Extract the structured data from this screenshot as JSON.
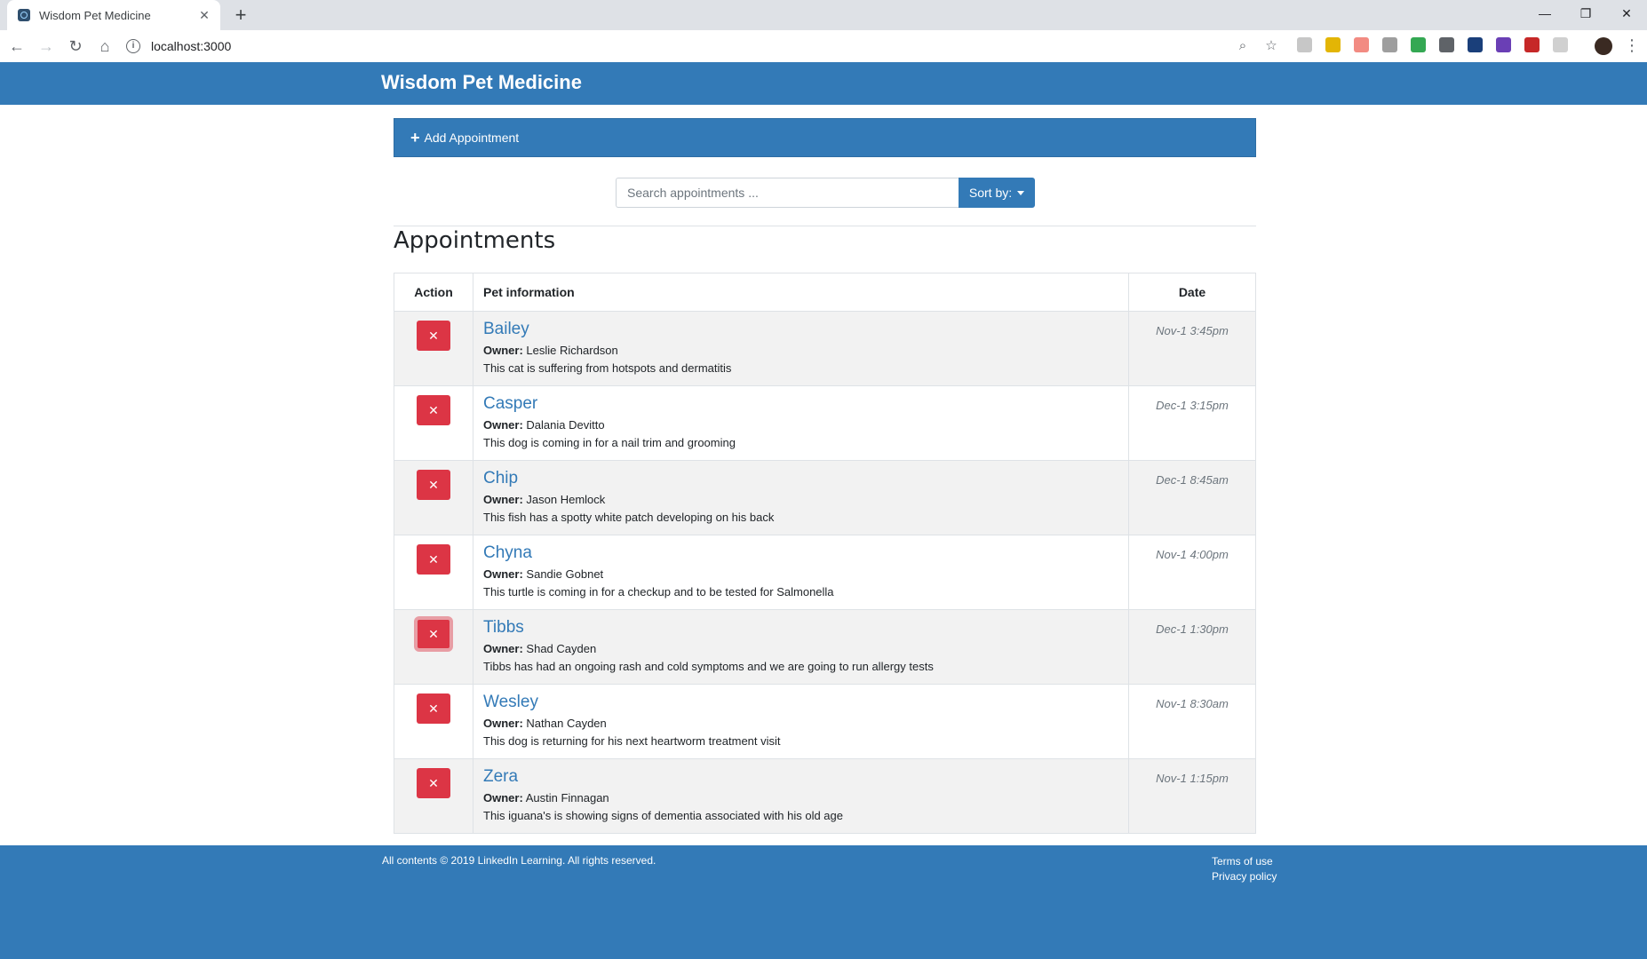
{
  "browser": {
    "tab_title": "Wisdom Pet Medicine",
    "url": "localhost:3000",
    "extension_colors": [
      "#c7c7c7",
      "#e3b505",
      "#f28b82",
      "#9e9e9e",
      "#34a853",
      "#5f6368",
      "#1a3f7a",
      "#6a3fb5",
      "#c62828",
      "#d0d0d0"
    ]
  },
  "header": {
    "brand": "Wisdom Pet Medicine"
  },
  "add_appointment": {
    "label": "Add Appointment"
  },
  "search": {
    "placeholder": "Search appointments ...",
    "sort_label": "Sort by:"
  },
  "appointments_title": "Appointments",
  "table": {
    "headers": {
      "action": "Action",
      "pet": "Pet information",
      "date": "Date"
    },
    "owner_label": "Owner:",
    "rows": [
      {
        "pet": "Bailey",
        "owner": "Leslie Richardson",
        "notes": "This cat is suffering from hotspots and dermatitis",
        "date": "Nov-1 3:45pm"
      },
      {
        "pet": "Casper",
        "owner": "Dalania Devitto",
        "notes": "This dog is coming in for a nail trim and grooming",
        "date": "Dec-1 3:15pm"
      },
      {
        "pet": "Chip",
        "owner": "Jason Hemlock",
        "notes": "This fish has a spotty white patch developing on his back",
        "date": "Dec-1 8:45am"
      },
      {
        "pet": "Chyna",
        "owner": "Sandie Gobnet",
        "notes": "This turtle is coming in for a checkup and to be tested for Salmonella",
        "date": "Nov-1 4:00pm"
      },
      {
        "pet": "Tibbs",
        "owner": "Shad Cayden",
        "notes": "Tibbs has had an ongoing rash and cold symptoms and we are going to run allergy tests",
        "date": "Dec-1 1:30pm"
      },
      {
        "pet": "Wesley",
        "owner": "Nathan Cayden",
        "notes": "This dog is returning for his next heartworm treatment visit",
        "date": "Nov-1 8:30am"
      },
      {
        "pet": "Zera",
        "owner": "Austin Finnagan",
        "notes": "This iguana's is showing signs of dementia associated with his old age",
        "date": "Nov-1 1:15pm"
      }
    ]
  },
  "footer": {
    "copyright": "All contents © 2019 LinkedIn Learning. All rights reserved.",
    "links": [
      "Terms of use",
      "Privacy policy"
    ]
  },
  "colors": {
    "primary": "#337ab7",
    "danger": "#dc3545"
  }
}
